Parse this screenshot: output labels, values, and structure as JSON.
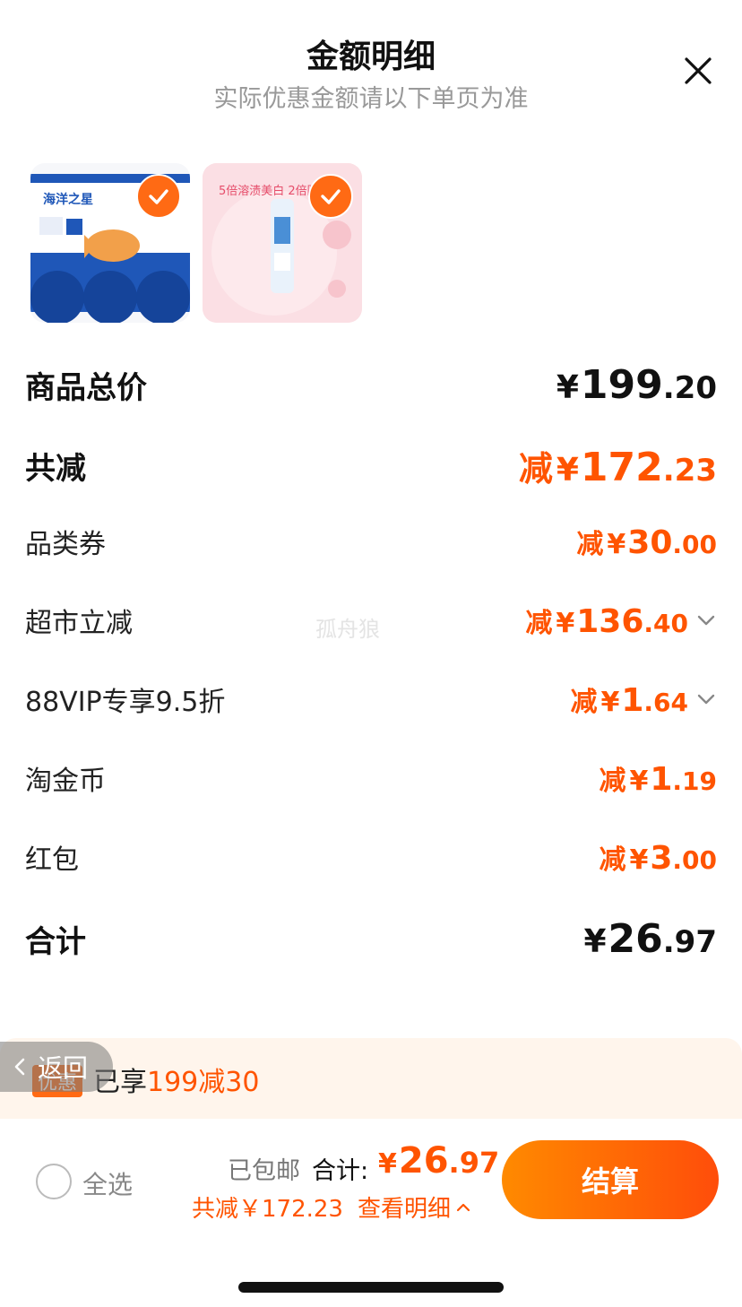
{
  "header": {
    "title": "金额明细",
    "subtitle": "实际优惠金额请以下单页为准"
  },
  "products": [
    {
      "name": "海洋之星",
      "icon": "fish-product-icon",
      "selected": true
    },
    {
      "name": "5倍溶渍美白 2倍防",
      "icon": "toothpaste-product-icon",
      "selected": true
    }
  ],
  "rows": [
    {
      "label": "商品总价",
      "prefix": "",
      "yen": "¥",
      "int": "199",
      "dec": ".20"
    },
    {
      "label": "共减",
      "prefix": "减",
      "yen": "¥",
      "int": "172",
      "dec": ".23"
    },
    {
      "label": "品类券",
      "prefix": "减",
      "yen": "¥",
      "int": "30",
      "dec": ".00"
    },
    {
      "label": "超市立减",
      "prefix": "减",
      "yen": "¥",
      "int": "136",
      "dec": ".40"
    },
    {
      "label": "88VIP专享9.5折",
      "prefix": "减",
      "yen": "¥",
      "int": "1",
      "dec": ".64"
    },
    {
      "label": "淘金币",
      "prefix": "减",
      "yen": "¥",
      "int": "1",
      "dec": ".19"
    },
    {
      "label": "红包",
      "prefix": "减",
      "yen": "¥",
      "int": "3",
      "dec": ".00"
    },
    {
      "label": "合计",
      "prefix": "",
      "yen": "¥",
      "int": "26",
      "dec": ".97"
    }
  ],
  "watermark": "孤舟狼",
  "promo": {
    "tag": "优惠",
    "text_prefix": "已享",
    "text_highlight": "199减30"
  },
  "back": {
    "label": "返回"
  },
  "footer": {
    "select_all": "全选",
    "free_shipping": "已包邮",
    "total_label": "合计:",
    "total_yen": "¥",
    "total_int": "26",
    "total_dec": ".97",
    "saved": "共减￥172.23",
    "detail": "查看明细",
    "checkout": "结算"
  },
  "colors": {
    "accent": "#ff5400",
    "button_start": "#ff8a00",
    "button_end": "#ff4d0a"
  }
}
